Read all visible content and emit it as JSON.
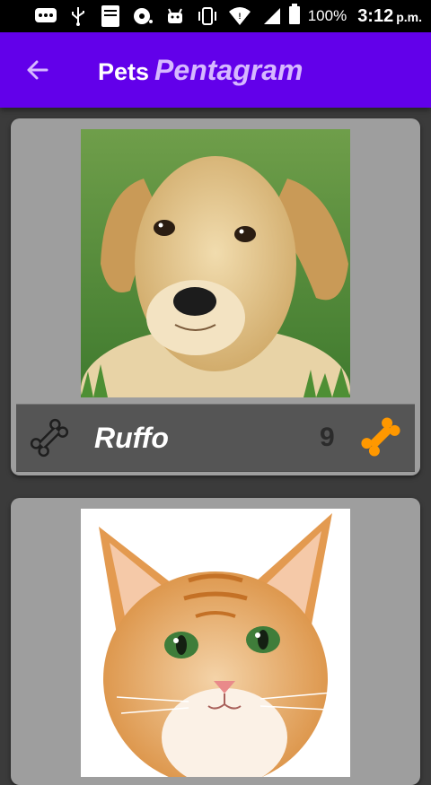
{
  "status_bar": {
    "battery_percent": "100%",
    "time": "3:12",
    "ampm": "p.m.",
    "icons": [
      "chat-icon",
      "usb-icon",
      "bible-app-icon",
      "cd-icon",
      "android-icon",
      "vibrate-icon",
      "wifi-icon",
      "signal-icon",
      "battery-icon"
    ]
  },
  "app_bar": {
    "title_main": "Pets",
    "title_accent": "Pentagram",
    "color": "#6200ea",
    "accent_color": "#d6b8ff",
    "back_icon": "arrow-back-icon"
  },
  "pets": [
    {
      "name": "Ruffo",
      "likes": "9",
      "photo": "puppy-photo"
    },
    {
      "name": "",
      "likes": "",
      "photo": "kitten-photo"
    }
  ],
  "colors": {
    "background": "#3b3b3b",
    "card": "#9e9e9e",
    "info_bar": "#555555",
    "like_bone": "#ff9800"
  }
}
